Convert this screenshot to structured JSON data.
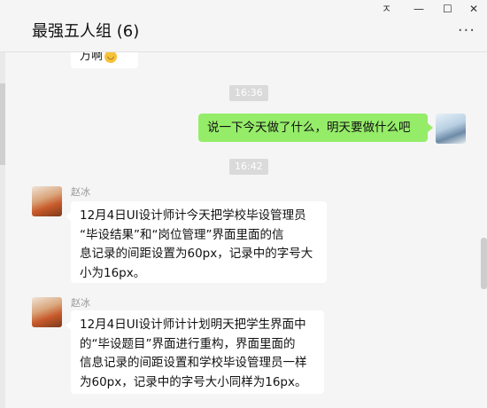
{
  "window": {
    "title": "最强五人组 (6)",
    "controls": {
      "pin": "ㅈ",
      "minimize": "—",
      "maximize": "☐",
      "close": "✕"
    },
    "more": "···"
  },
  "messages": {
    "partial_prev": {
      "text": "万啊",
      "emoji": "😄"
    },
    "time1": "16:36",
    "me_msg": "说一下今天做了什么，明天要做什么吧",
    "time2": "16:42",
    "msg1": {
      "sender": "赵冰",
      "lines": [
        "12月4日UI设计师计今天把学校毕设管理员",
        "“毕设结果”和“岗位管理”界面里面的信",
        "息记录的间距设置为60px，记录中的字号大",
        "小为16px。"
      ]
    },
    "msg2": {
      "sender": "赵冰",
      "lines": [
        "12月4日UI设计师计计划明天把学生界面中",
        "的“毕设题目”界面进行重构，界面里面的",
        "信息记录的间距设置和学校毕设管理员一样",
        "为60px，记录中的字号大小同样为16px。"
      ]
    }
  },
  "colors": {
    "background": "#f5f5f5",
    "my_bubble": "#95ec69",
    "other_bubble": "#ffffff",
    "time_badge": "#dadada"
  },
  "icons": [
    "pin-icon",
    "minimize-icon",
    "maximize-icon",
    "close-icon",
    "more-options-icon",
    "user-avatar"
  ]
}
